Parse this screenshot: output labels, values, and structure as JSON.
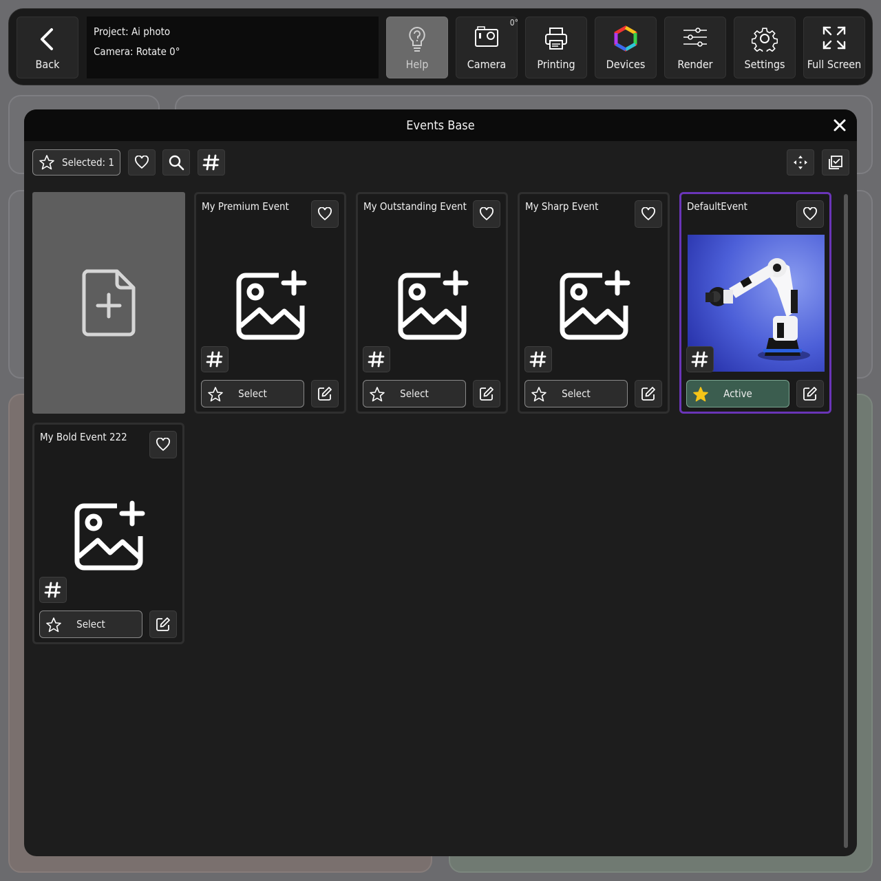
{
  "toolbar": {
    "back_label": "Back",
    "project_line": "Project: Ai photo",
    "camera_line": "Camera: Rotate 0°",
    "help_label": "Help",
    "camera_label": "Camera",
    "camera_rotation": "0°",
    "printing_label": "Printing",
    "devices_label": "Devices",
    "render_label": "Render",
    "settings_label": "Settings",
    "fullscreen_label": "Full Screen"
  },
  "modal": {
    "title": "Events Base",
    "selected_label": "Selected: 1"
  },
  "events": [
    {
      "title": "My Premium Event",
      "action": "Select",
      "active": false
    },
    {
      "title": "My Outstanding Event",
      "action": "Select",
      "active": false
    },
    {
      "title": "My Sharp Event",
      "action": "Select",
      "active": false
    },
    {
      "title": "DefaultEvent",
      "action": "Active",
      "active": true
    },
    {
      "title": "My Bold Event 222",
      "action": "Select",
      "active": false
    }
  ],
  "colors": {
    "active_border": "#6a35b8",
    "active_button": "#3b5d4f",
    "active_star": "#f5c518"
  },
  "icons": [
    "back-icon",
    "help-icon",
    "camera-icon",
    "printer-icon",
    "devices-icon",
    "render-icon",
    "settings-icon",
    "fullscreen-icon",
    "close-icon",
    "star-icon",
    "heart-icon",
    "search-icon",
    "hash-icon",
    "move-icon",
    "select-all-icon",
    "add-file-icon",
    "add-image-icon",
    "edit-icon"
  ]
}
